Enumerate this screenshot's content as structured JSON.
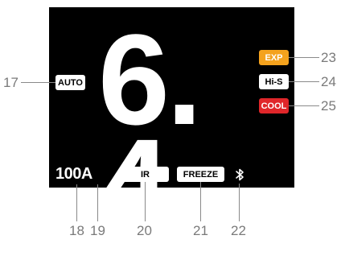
{
  "display": {
    "reading_int": "6",
    "reading_dot": ".",
    "reading_frac": "4",
    "range": "100A",
    "bluetooth_icon": "bluetooth-icon"
  },
  "badges": {
    "auto": "AUTO",
    "exp": "EXP",
    "his": "Hi-S",
    "cool": "COOL",
    "ir": "IR",
    "freeze": "FREEZE"
  },
  "colors": {
    "screen": "#000000",
    "exp": "#f4a21d",
    "cool": "#e0262a",
    "badge_default": "#ffffff",
    "callout": "#7a7a7a"
  },
  "callouts": {
    "c17": "17",
    "c18": "18",
    "c19": "19",
    "c20": "20",
    "c21": "21",
    "c22": "22",
    "c23": "23",
    "c24": "24",
    "c25": "25"
  }
}
